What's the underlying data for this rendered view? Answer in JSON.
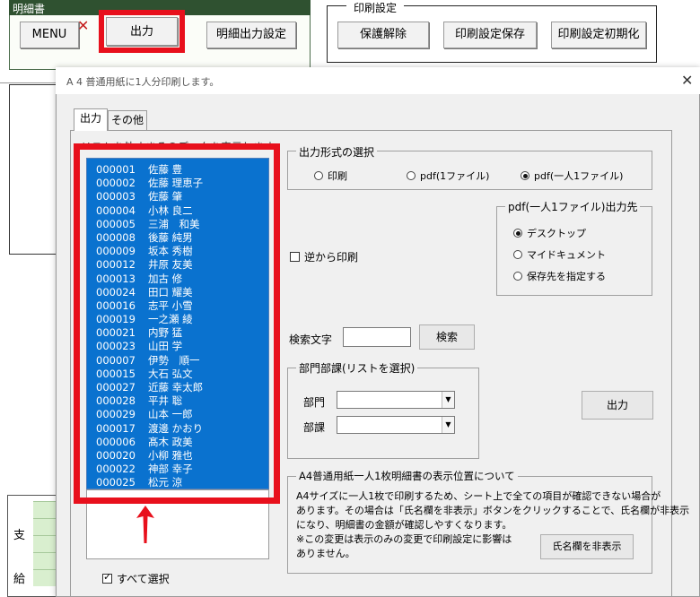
{
  "sheet": {
    "title": "明細書",
    "menu_button": "MENU",
    "output_button": "出力",
    "detail_output_settings_button": "明細出力設定",
    "print_settings_caption": "印刷設定",
    "unprotect_button": "保護解除",
    "save_print_settings_button": "印刷設定保存",
    "reset_print_settings_button": "印刷設定初期化",
    "table_labels": [
      "支",
      "給"
    ]
  },
  "dialog": {
    "title": "A 4 普通用紙に1人分印刷します。",
    "tabs": [
      "出力",
      "その他"
    ],
    "list_caption": "リストを外すまそのデータを表示します",
    "employees": [
      {
        "id": "000001",
        "name": "佐藤 豊"
      },
      {
        "id": "000002",
        "name": "佐藤 理恵子"
      },
      {
        "id": "000003",
        "name": "佐藤 肇"
      },
      {
        "id": "000004",
        "name": "小林 良二"
      },
      {
        "id": "000005",
        "name": "三浦　和美"
      },
      {
        "id": "000008",
        "name": "後藤 純男"
      },
      {
        "id": "000009",
        "name": "坂本 秀樹"
      },
      {
        "id": "000012",
        "name": "井原 友美"
      },
      {
        "id": "000013",
        "name": "加古 修"
      },
      {
        "id": "000024",
        "name": "田口 耀美"
      },
      {
        "id": "000016",
        "name": "志平 小雪"
      },
      {
        "id": "000019",
        "name": "一之瀬 綾"
      },
      {
        "id": "000021",
        "name": "内野 猛"
      },
      {
        "id": "000023",
        "name": "山田 学"
      },
      {
        "id": "000007",
        "name": "伊勢　順一"
      },
      {
        "id": "000015",
        "name": "大石 弘文"
      },
      {
        "id": "000027",
        "name": "近藤 幸太郎"
      },
      {
        "id": "000028",
        "name": "平井 聡"
      },
      {
        "id": "000029",
        "name": "山本 一郎"
      },
      {
        "id": "000017",
        "name": "渡邊 かおり"
      },
      {
        "id": "000006",
        "name": "髙木 政美"
      },
      {
        "id": "000020",
        "name": "小柳 雅也"
      },
      {
        "id": "000022",
        "name": "神部 幸子"
      },
      {
        "id": "000025",
        "name": "松元 涼"
      }
    ],
    "select_all_label": "すべて選択",
    "output_format": {
      "caption": "出力形式の選択",
      "options": [
        "印刷",
        "pdf(1ファイル)",
        "pdf(一人1ファイル)"
      ],
      "selected": "pdf(一人1ファイル)"
    },
    "reverse_print_label": "逆から印刷",
    "pdf_destination": {
      "caption": "pdf(一人1ファイル)出力先",
      "options": [
        "デスクトップ",
        "マイドキュメント",
        "保存先を指定する"
      ],
      "selected": "デスクトップ"
    },
    "search": {
      "label": "検索文字",
      "value": "",
      "button": "検索"
    },
    "department": {
      "caption": "部門部課(リストを選択)",
      "dept_label": "部門",
      "section_label": "部課",
      "dept_value": "",
      "section_value": ""
    },
    "output_button": "出力",
    "note": {
      "caption": "A4普通用紙一人1枚明細書の表示位置について",
      "lines": [
        "A4サイズに一人1枚で印刷するため、シート上で全ての項目が確認できない場合が",
        "あります。その場合は「氏名欄を非表示」ボタンをクリックすることで、氏名欄が非表示",
        "になり、明細書の金額が確認しやすくなります。",
        "※この変更は表示のみの変更で印刷設定に影響は",
        "ありません。"
      ],
      "hide_name_button": "氏名欄を非表示"
    }
  }
}
